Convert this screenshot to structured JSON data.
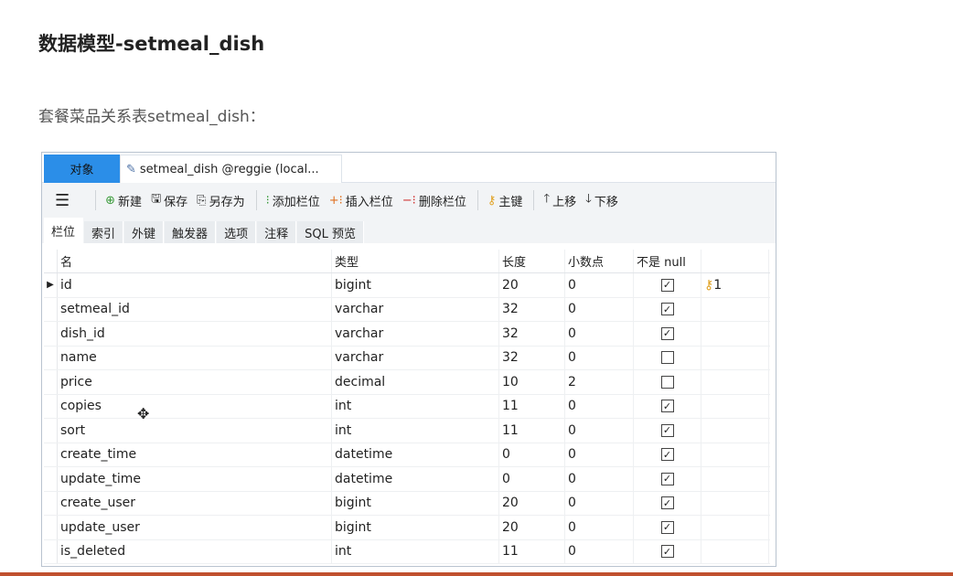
{
  "heading": "数据模型-setmeal_dish",
  "subtitle": "套餐菜品关系表setmeal_dish：",
  "window": {
    "tab_objects": "对象",
    "tab_document": "setmeal_dish @reggie (local...",
    "toolbar": {
      "new": "新建",
      "save": "保存",
      "save_as": "另存为",
      "add_field": "添加栏位",
      "insert_field": "插入栏位",
      "delete_field": "删除栏位",
      "primary_key": "主键",
      "move_up": "上移",
      "move_down": "下移"
    },
    "subtabs": [
      "栏位",
      "索引",
      "外键",
      "触发器",
      "选项",
      "注释",
      "SQL 预览"
    ],
    "columns": [
      "名",
      "类型",
      "长度",
      "小数点",
      "不是 null",
      ""
    ],
    "rows": [
      {
        "name": "id",
        "type": "bigint",
        "length": "20",
        "decimal": "0",
        "not_null": true,
        "key": "1"
      },
      {
        "name": "setmeal_id",
        "type": "varchar",
        "length": "32",
        "decimal": "0",
        "not_null": true,
        "key": ""
      },
      {
        "name": "dish_id",
        "type": "varchar",
        "length": "32",
        "decimal": "0",
        "not_null": true,
        "key": ""
      },
      {
        "name": "name",
        "type": "varchar",
        "length": "32",
        "decimal": "0",
        "not_null": false,
        "key": ""
      },
      {
        "name": "price",
        "type": "decimal",
        "length": "10",
        "decimal": "2",
        "not_null": false,
        "key": ""
      },
      {
        "name": "copies",
        "type": "int",
        "length": "11",
        "decimal": "0",
        "not_null": true,
        "key": ""
      },
      {
        "name": "sort",
        "type": "int",
        "length": "11",
        "decimal": "0",
        "not_null": true,
        "key": ""
      },
      {
        "name": "create_time",
        "type": "datetime",
        "length": "0",
        "decimal": "0",
        "not_null": true,
        "key": ""
      },
      {
        "name": "update_time",
        "type": "datetime",
        "length": "0",
        "decimal": "0",
        "not_null": true,
        "key": ""
      },
      {
        "name": "create_user",
        "type": "bigint",
        "length": "20",
        "decimal": "0",
        "not_null": true,
        "key": ""
      },
      {
        "name": "update_user",
        "type": "bigint",
        "length": "20",
        "decimal": "0",
        "not_null": true,
        "key": ""
      },
      {
        "name": "is_deleted",
        "type": "int",
        "length": "11",
        "decimal": "0",
        "not_null": true,
        "key": ""
      }
    ]
  },
  "colors": {
    "accent": "#2b8ee8",
    "bottom_bar": "#c0502e"
  }
}
